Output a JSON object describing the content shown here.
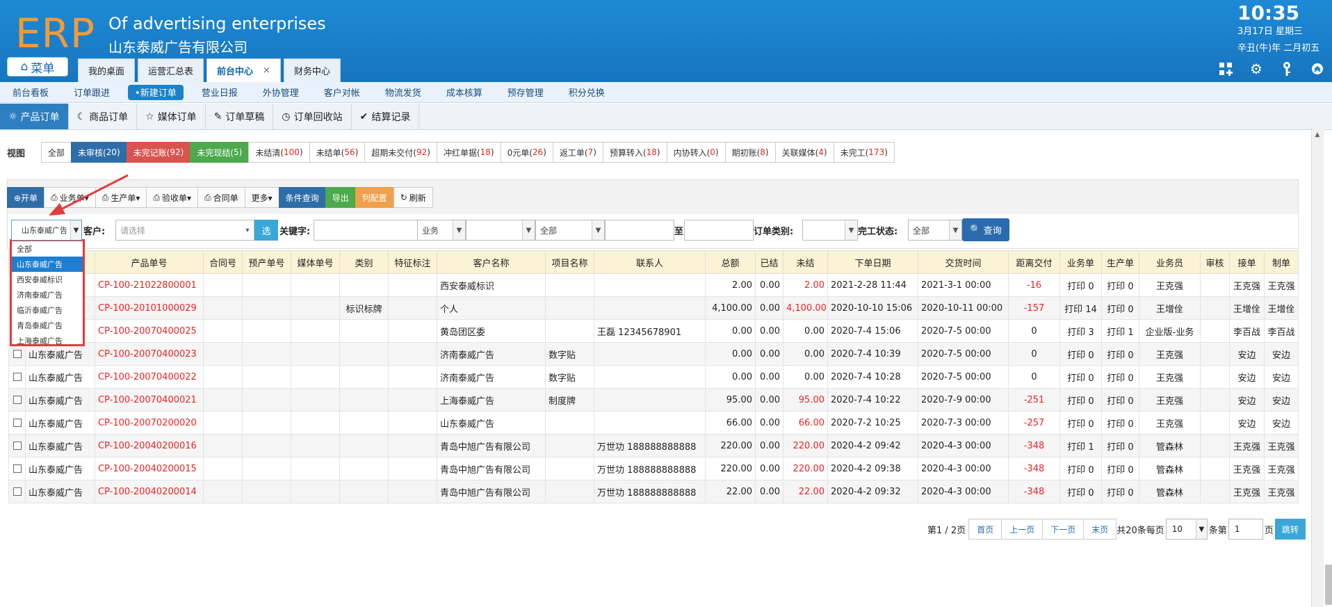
{
  "header": {
    "logo": "ERP",
    "brand_en": "Of advertising enterprises",
    "brand_cn": "山东泰威广告有限公司",
    "clock": "10:35",
    "date_line1": "3月17日 星期三",
    "date_line2": "辛丑(牛)年 二月初五",
    "menu_label": "菜单",
    "icons": [
      "apps-icon",
      "gear-icon",
      "key-icon",
      "collapse-icon"
    ]
  },
  "top_tabs": [
    {
      "label": "我的桌面"
    },
    {
      "label": "运营汇总表"
    },
    {
      "label": "前台中心",
      "close": "×"
    },
    {
      "label": "财务中心"
    }
  ],
  "nav2": [
    "前台看板",
    "订单跟进",
    "•新建订单",
    "营业日报",
    "外协管理",
    "客户对帐",
    "物流发货",
    "成本核算",
    "预存管理",
    "积分兑换"
  ],
  "nav3": [
    "产品订单",
    "商品订单",
    "媒体订单",
    "订单草稿",
    "订单回收站",
    "结算记录"
  ],
  "view": {
    "label": "视图",
    "buttons": [
      {
        "text": "全部",
        "n": "",
        "style": ""
      },
      {
        "text": "未审核(",
        "n": "20",
        "end": ")",
        "style": "blue"
      },
      {
        "text": "未完记账(",
        "n": "92",
        "end": ")",
        "style": "red"
      },
      {
        "text": "未完现结(",
        "n": "5",
        "end": ")",
        "style": "green"
      },
      {
        "text": "未结清(",
        "n": "100",
        "end": ")",
        "style": ""
      },
      {
        "text": "未结单(",
        "n": "56",
        "end": ")",
        "style": ""
      },
      {
        "text": "超期未交付(",
        "n": "92",
        "end": ")",
        "style": ""
      },
      {
        "text": "冲红单据(",
        "n": "18",
        "end": ")",
        "style": ""
      },
      {
        "text": "0元单(",
        "n": "26",
        "end": ")",
        "style": ""
      },
      {
        "text": "返工单(",
        "n": "7",
        "end": ")",
        "style": ""
      },
      {
        "text": "预算转入(",
        "n": "18",
        "end": ")",
        "style": ""
      },
      {
        "text": "内协转入(",
        "n": "0",
        "end": ")",
        "style": ""
      },
      {
        "text": "期初账(",
        "n": "8",
        "end": ")",
        "style": ""
      },
      {
        "text": "关联媒体(",
        "n": "4",
        "end": ")",
        "style": ""
      },
      {
        "text": "未完工(",
        "n": "173",
        "end": ")",
        "style": ""
      }
    ]
  },
  "toolbar": [
    {
      "label": "⊕开单",
      "style": "blue"
    },
    {
      "label": "业务单▾",
      "style": ""
    },
    {
      "label": "生产单▾",
      "style": ""
    },
    {
      "label": "验收单▾",
      "style": ""
    },
    {
      "label": "合同单",
      "style": ""
    },
    {
      "label": "更多▾",
      "style": ""
    },
    {
      "label": "条件查询",
      "style": "blue"
    },
    {
      "label": "导出",
      "style": "green"
    },
    {
      "label": "列配置",
      "style": "orange"
    },
    {
      "label": "刷新",
      "style": ""
    }
  ],
  "filters": {
    "company_value": "山东泰威广告",
    "customer_label": "客户:",
    "customer_placeholder": "请选择",
    "select_btn": "选",
    "keyword_label": "关键字:",
    "type_value": "业务",
    "date_range_value": "全部",
    "to_label": "至",
    "order_type_label": "订单类别:",
    "finish_label": "完工状态:",
    "finish_value": "全部",
    "query_label": "查询"
  },
  "dropdown": {
    "options": [
      "全部",
      "山东泰威广告",
      "西安泰威标识",
      "济南泰威广告",
      "临沂泰威广告",
      "青岛泰威广告",
      "上海泰威广告"
    ],
    "selected_index": 1
  },
  "table": {
    "headers": [
      "",
      "",
      "产品单号",
      "合同号",
      "预产单号",
      "媒体单号",
      "类别",
      "特征标注",
      "客户名称",
      "项目名称",
      "联系人",
      "总额",
      "已结",
      "未结",
      "下单日期",
      "交货时间",
      "距离交付",
      "业务单",
      "生产单",
      "业务员",
      "审核",
      "接单",
      "制单"
    ],
    "rows": [
      {
        "company": "",
        "no": "CP-100-21022800001",
        "cat": "",
        "customer": "西安泰威标识",
        "project": "",
        "contact": "",
        "total": "2.00",
        "paid": "0.00",
        "unpaid": "2.00",
        "order_date": "2021-2-28 11:44",
        "delivery": "2021-3-1 00:00",
        "days": "-16",
        "biz": "打印 0",
        "prod": "打印 0",
        "sales": "王克强",
        "audit": "",
        "recv": "王克强",
        "maker": "王克强"
      },
      {
        "company": "",
        "no": "CP-100-20101000029",
        "cat": "标识标牌",
        "customer": "个人",
        "project": "",
        "contact": "",
        "total": "4,100.00",
        "paid": "0.00",
        "unpaid": "4,100.00",
        "order_date": "2020-10-10 15:06",
        "delivery": "2020-10-11 00:00",
        "days": "-157",
        "biz": "打印 14",
        "prod": "打印 0",
        "sales": "王增佺",
        "audit": "",
        "recv": "王增佺",
        "maker": "王增佺"
      },
      {
        "company": "",
        "no": "CP-100-20070400025",
        "cat": "",
        "customer": "黄岛团区委",
        "project": "",
        "contact": "王磊 12345678901",
        "total": "0.00",
        "paid": "0.00",
        "unpaid": "0.00",
        "order_date": "2020-7-4 15:06",
        "delivery": "2020-7-5 00:00",
        "days": "0",
        "biz": "打印 3",
        "prod": "打印 1",
        "sales": "企业版-业务",
        "audit": "",
        "recv": "李百战",
        "maker": "李百战"
      },
      {
        "company": "山东泰威广告",
        "no": "CP-100-20070400023",
        "cat": "",
        "customer": "济南泰威广告",
        "project": "数字贴",
        "contact": "",
        "total": "0.00",
        "paid": "0.00",
        "unpaid": "0.00",
        "order_date": "2020-7-4 10:39",
        "delivery": "2020-7-5 00:00",
        "days": "0",
        "biz": "打印 0",
        "prod": "打印 0",
        "sales": "王克强",
        "audit": "",
        "recv": "安边",
        "maker": "安边"
      },
      {
        "company": "山东泰威广告",
        "no": "CP-100-20070400022",
        "cat": "",
        "customer": "济南泰威广告",
        "project": "数字贴",
        "contact": "",
        "total": "0.00",
        "paid": "0.00",
        "unpaid": "0.00",
        "order_date": "2020-7-4 10:28",
        "delivery": "2020-7-5 00:00",
        "days": "0",
        "biz": "打印 0",
        "prod": "打印 0",
        "sales": "王克强",
        "audit": "",
        "recv": "安边",
        "maker": "安边"
      },
      {
        "company": "山东泰威广告",
        "no": "CP-100-20070400021",
        "cat": "",
        "customer": "上海泰威广告",
        "project": "制度牌",
        "contact": "",
        "total": "95.00",
        "paid": "0.00",
        "unpaid": "95.00",
        "order_date": "2020-7-4 10:22",
        "delivery": "2020-7-9 00:00",
        "days": "-251",
        "biz": "打印 0",
        "prod": "打印 0",
        "sales": "王克强",
        "audit": "",
        "recv": "安边",
        "maker": "安边"
      },
      {
        "company": "山东泰威广告",
        "no": "CP-100-20070200020",
        "cat": "",
        "customer": "山东泰威广告",
        "project": "",
        "contact": "",
        "total": "66.00",
        "paid": "0.00",
        "unpaid": "66.00",
        "order_date": "2020-7-2 10:25",
        "delivery": "2020-7-3 00:00",
        "days": "-257",
        "biz": "打印 0",
        "prod": "打印 0",
        "sales": "王克强",
        "audit": "",
        "recv": "安边",
        "maker": "安边"
      },
      {
        "company": "山东泰威广告",
        "no": "CP-100-20040200016",
        "cat": "",
        "customer": "青岛中旭广告有限公司",
        "project": "",
        "contact": "万世功 188888888888",
        "total": "220.00",
        "paid": "0.00",
        "unpaid": "220.00",
        "order_date": "2020-4-2 09:42",
        "delivery": "2020-4-3 00:00",
        "days": "-348",
        "biz": "打印 1",
        "prod": "打印 0",
        "sales": "管森林",
        "audit": "",
        "recv": "王克强",
        "maker": "王克强"
      },
      {
        "company": "山东泰威广告",
        "no": "CP-100-20040200015",
        "cat": "",
        "customer": "青岛中旭广告有限公司",
        "project": "",
        "contact": "万世功 188888888888",
        "total": "220.00",
        "paid": "0.00",
        "unpaid": "220.00",
        "order_date": "2020-4-2 09:38",
        "delivery": "2020-4-3 00:00",
        "days": "-348",
        "biz": "打印 0",
        "prod": "打印 0",
        "sales": "管森林",
        "audit": "",
        "recv": "王克强",
        "maker": "王克强"
      },
      {
        "company": "山东泰威广告",
        "no": "CP-100-20040200014",
        "cat": "",
        "customer": "青岛中旭广告有限公司",
        "project": "",
        "contact": "万世功 188888888888",
        "total": "22.00",
        "paid": "0.00",
        "unpaid": "22.00",
        "order_date": "2020-4-2 09:32",
        "delivery": "2020-4-3 00:00",
        "days": "-348",
        "biz": "打印 0",
        "prod": "打印 0",
        "sales": "管森林",
        "audit": "",
        "recv": "王克强",
        "maker": "王克强"
      }
    ]
  },
  "pager": {
    "info": "第1 / 2页",
    "first": "首页",
    "prev": "上一页",
    "next": "下一页",
    "last": "末页",
    "total_text": "共20条每页",
    "page_size": "10",
    "unit_text": "条第",
    "page_input": "1",
    "page_text": "页",
    "jump": "跳转"
  },
  "colors": {
    "header_blue": "#1b80cc",
    "logo_orange": "#f39a3a",
    "accent_red": "#e22222"
  }
}
